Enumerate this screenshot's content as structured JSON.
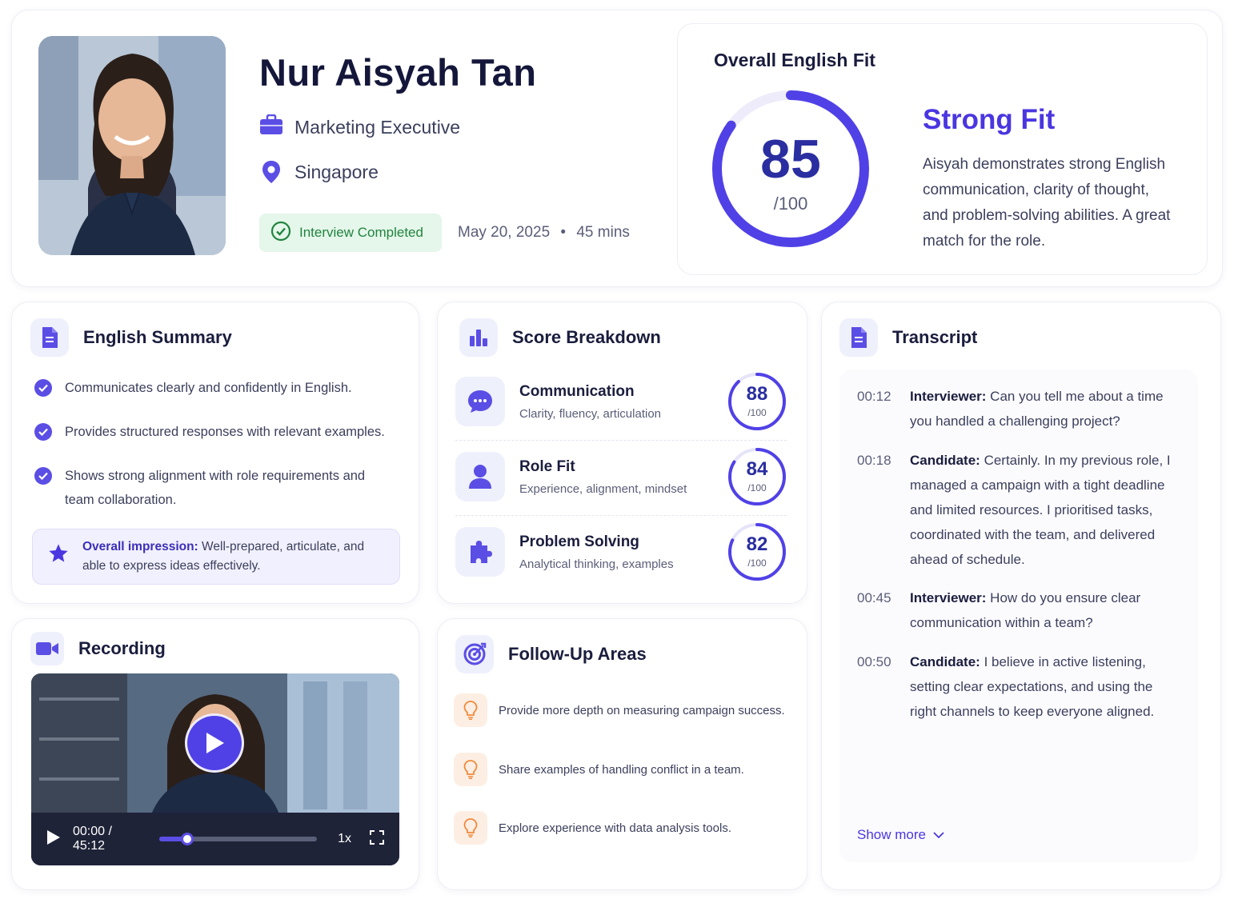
{
  "profile": {
    "name": "Nur Aisyah Tan",
    "role": "Marketing Executive",
    "location": "Singapore",
    "status": "Interview Completed",
    "date": "May 20, 2025",
    "separator": "•",
    "duration": "45 mins"
  },
  "overall": {
    "title": "Overall English Fit",
    "score": "85",
    "score_value": 85,
    "max": "/100",
    "label": "Strong Fit",
    "description": "Aisyah demonstrates strong English communication, clarity of thought, and problem-solving abilities. A great match for the role."
  },
  "summary": {
    "title": "English Summary",
    "items": [
      "Communicates clearly and confidently in English.",
      "Provides structured responses with relevant examples.",
      "Shows strong alignment with role requirements and team collaboration."
    ],
    "impression_label": "Overall impression:",
    "impression_text": " Well-prepared, articulate, and able to express ideas effectively."
  },
  "breakdown": {
    "title": "Score Breakdown",
    "items": [
      {
        "title": "Communication",
        "subtitle": "Clarity, fluency, articulation",
        "score": "88",
        "value": 88,
        "max": "/100",
        "icon": "chat-bubble-icon"
      },
      {
        "title": "Role Fit",
        "subtitle": "Experience, alignment, mindset",
        "score": "84",
        "value": 84,
        "max": "/100",
        "icon": "person-icon"
      },
      {
        "title": "Problem Solving",
        "subtitle": "Analytical thinking, examples",
        "score": "82",
        "value": 82,
        "max": "/100",
        "icon": "puzzle-icon"
      }
    ]
  },
  "transcript": {
    "title": "Transcript",
    "items": [
      {
        "time": "00:12",
        "speaker": "Interviewer:",
        "text": " Can you tell me about a time you handled a challenging project?"
      },
      {
        "time": "00:18",
        "speaker": "Candidate:",
        "text": " Certainly. In my previous role, I managed a campaign with a tight deadline and limited resources. I prioritised tasks, coordinated with the team, and delivered ahead of schedule."
      },
      {
        "time": "00:45",
        "speaker": "Interviewer:",
        "text": " How do you ensure clear communication within a team?"
      },
      {
        "time": "00:50",
        "speaker": "Candidate:",
        "text": " I believe in active listening, setting clear expectations, and using the right channels to keep everyone aligned."
      }
    ],
    "show_more": "Show more"
  },
  "recording": {
    "title": "Recording",
    "time": "00:00 / 45:12",
    "progress": 0.17,
    "speed": "1x"
  },
  "followup": {
    "title": "Follow-Up Areas",
    "items": [
      "Provide more depth on measuring campaign success.",
      "Share examples of handling conflict in a team.",
      "Explore experience with data analysis tools."
    ]
  },
  "colors": {
    "accent": "#4a36e0",
    "score_text": "#2a2ea0",
    "success": "#21843f",
    "success_bg": "#e5f6ea",
    "followup": "#f08a3c"
  }
}
